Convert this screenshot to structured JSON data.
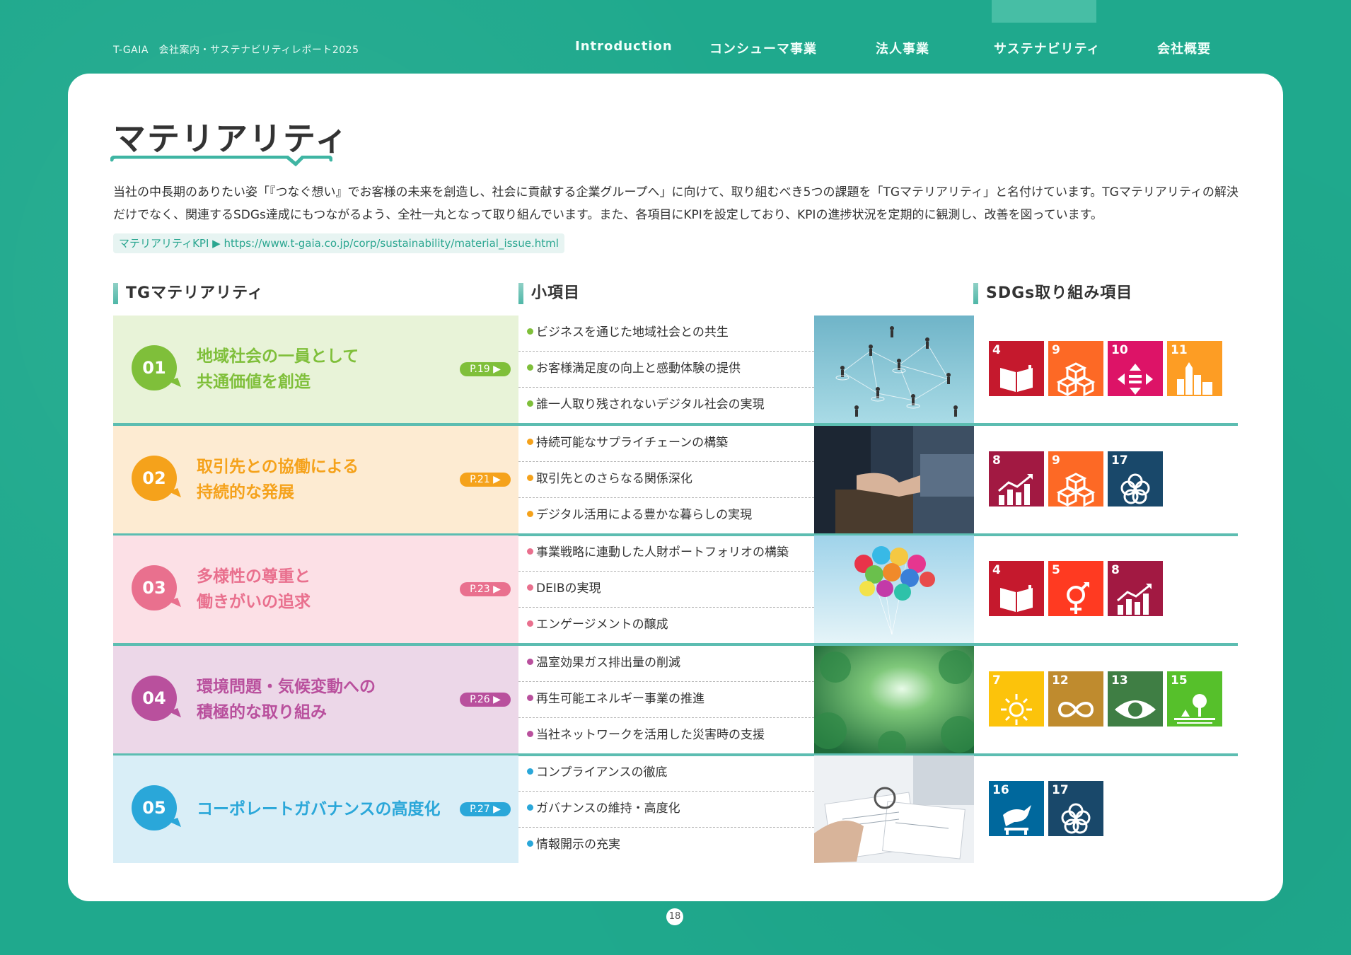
{
  "header": {
    "brand": "T-GAIA　会社案内・サステナビリティレポート2025",
    "nav": [
      "Introduction",
      "コンシューマ事業",
      "法人事業",
      "サステナビリティ",
      "会社概要"
    ],
    "active_nav": "サステナビリティ"
  },
  "page_title": "マテリアリティ",
  "intro": "当社の中長期のありたい姿「『つなぐ想い』でお客様の未来を創造し、社会に貢献する企業グループへ」に向けて、取り組むべき5つの課題を「TGマテリアリティ」と名付けています。TGマテリアリティの解決だけでなく、関連するSDGs達成にもつながるよう、全社一丸となって取り組んでいます。また、各項目にKPIを設定しており、KPIの進捗状況を定期的に観測し、改善を図っています。",
  "kpi_link": {
    "label": "マテリアリティKPI ▶ ",
    "url": "https://www.t-gaia.co.jp/corp/sustainability/material_issue.html"
  },
  "columns": {
    "materiality": "TGマテリアリティ",
    "subitems": "小項目",
    "sdgs": "SDGs取り組み項目"
  },
  "materialities": [
    {
      "num": "01",
      "line1": "地域社会の一員として",
      "line2": "共通価値を創造",
      "page": "P.19 ▶",
      "color": "#7fbf3a",
      "bg": "#e8f3d8",
      "subs": [
        "ビジネスを通じた地域社会との共生",
        "お客様満足度の向上と感動体験の提供",
        "誰一人取り残されないデジタル社会の実現"
      ],
      "photo": "network-people-photo",
      "sdgs": [
        {
          "num": "4",
          "color": "#c5192d",
          "icon": "book-icon"
        },
        {
          "num": "9",
          "color": "#fd6925",
          "icon": "cubes-icon"
        },
        {
          "num": "10",
          "color": "#dd1367",
          "icon": "equality-icon"
        },
        {
          "num": "11",
          "color": "#fd9d24",
          "icon": "city-icon"
        }
      ]
    },
    {
      "num": "02",
      "line1": "取引先との協働による",
      "line2": "持続的な発展",
      "page": "P.21 ▶",
      "color": "#f5a21b",
      "bg": "#fdebd2",
      "subs": [
        "持続可能なサプライチェーンの構築",
        "取引先とのさらなる関係深化",
        "デジタル活用による豊かな暮らしの実現"
      ],
      "photo": "handshake-photo",
      "sdgs": [
        {
          "num": "8",
          "color": "#a21942",
          "icon": "growth-icon"
        },
        {
          "num": "9",
          "color": "#fd6925",
          "icon": "cubes-icon"
        },
        {
          "num": "17",
          "color": "#19486a",
          "icon": "partnership-icon"
        }
      ]
    },
    {
      "num": "03",
      "line1": "多様性の尊重と",
      "line2": "働きがいの追求",
      "page": "P.23 ▶",
      "color": "#e9708e",
      "bg": "#fce0e6",
      "subs": [
        "事業戦略に連動した人財ポートフォリオの構築",
        "DEIBの実現",
        "エンゲージメントの醸成"
      ],
      "photo": "balloons-photo",
      "sdgs": [
        {
          "num": "4",
          "color": "#c5192d",
          "icon": "book-icon"
        },
        {
          "num": "5",
          "color": "#ff3a21",
          "icon": "gender-icon"
        },
        {
          "num": "8",
          "color": "#a21942",
          "icon": "growth-icon"
        }
      ]
    },
    {
      "num": "04",
      "line1": "環境問題・気候変動への",
      "line2": "積極的な取り組み",
      "page": "P.26 ▶",
      "color": "#b9509d",
      "bg": "#ecd7e8",
      "subs": [
        "温室効果ガス排出量の削減",
        "再生可能エネルギー事業の推進",
        "当社ネットワークを活用した災害時の支援"
      ],
      "photo": "forest-photo",
      "sdgs": [
        {
          "num": "7",
          "color": "#fcc30b",
          "icon": "sun-icon"
        },
        {
          "num": "12",
          "color": "#bf8b2e",
          "icon": "infinity-icon"
        },
        {
          "num": "13",
          "color": "#3f7e44",
          "icon": "eye-globe-icon"
        },
        {
          "num": "15",
          "color": "#56c02b",
          "icon": "tree-icon"
        }
      ]
    },
    {
      "num": "05",
      "line1": "コーポレートガバナンスの高度化",
      "line2": "",
      "page": "P.27 ▶",
      "color": "#2aa7d9",
      "bg": "#d9eef7",
      "subs": [
        "コンプライアンスの徹底",
        "ガバナンスの維持・高度化",
        "情報開示の充実"
      ],
      "photo": "documents-photo",
      "sdgs": [
        {
          "num": "16",
          "color": "#00689d",
          "icon": "dove-icon"
        },
        {
          "num": "17",
          "color": "#19486a",
          "icon": "partnership-icon"
        }
      ]
    }
  ],
  "page_number": "18"
}
